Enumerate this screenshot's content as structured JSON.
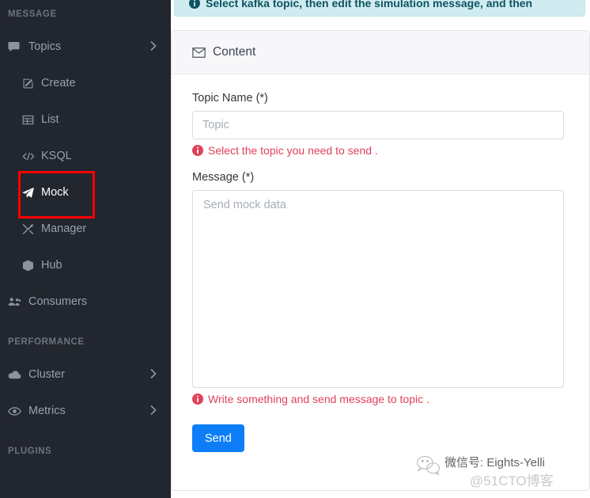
{
  "sidebar": {
    "sections": [
      {
        "title": "MESSAGE",
        "items": [
          {
            "label": "Topics",
            "icon": "comment-icon",
            "level": "top",
            "chevron": true,
            "active": false
          },
          {
            "label": "Create",
            "icon": "edit-icon",
            "level": "sub",
            "chevron": false,
            "active": false
          },
          {
            "label": "List",
            "icon": "table-icon",
            "level": "sub",
            "chevron": false,
            "active": false
          },
          {
            "label": "KSQL",
            "icon": "code-icon",
            "level": "sub",
            "chevron": false,
            "active": false
          },
          {
            "label": "Mock",
            "icon": "paper-plane-icon",
            "level": "sub",
            "chevron": false,
            "active": true
          },
          {
            "label": "Manager",
            "icon": "tools-icon",
            "level": "sub",
            "chevron": false,
            "active": false
          },
          {
            "label": "Hub",
            "icon": "cube-icon",
            "level": "sub",
            "chevron": false,
            "active": false
          },
          {
            "label": "Consumers",
            "icon": "users-icon",
            "level": "top",
            "chevron": false,
            "active": false
          }
        ]
      },
      {
        "title": "PERFORMANCE",
        "items": [
          {
            "label": "Cluster",
            "icon": "cloud-icon",
            "level": "top",
            "chevron": true,
            "active": false
          },
          {
            "label": "Metrics",
            "icon": "eye-icon",
            "level": "top",
            "chevron": true,
            "active": false
          }
        ]
      },
      {
        "title": "PLUGINS",
        "items": []
      }
    ],
    "highlight": {
      "target": "Mock",
      "color": "#fe0000"
    }
  },
  "alert": {
    "icon": "info-circle-icon",
    "text": "Select kafka topic, then edit the simulation message, and then",
    "background": "#d1ecf1",
    "border": "#bee5eb",
    "text_color": "#0c5460"
  },
  "card": {
    "header": {
      "icon": "envelope-icon",
      "title": "Content"
    },
    "fields": {
      "topic": {
        "label": "Topic Name (*)",
        "value": "",
        "placeholder": "Topic",
        "help_icon": "info-circle-icon",
        "help_text": "Select the topic you need to send ."
      },
      "message": {
        "label": "Message (*)",
        "value": "",
        "placeholder": "Send mock data",
        "help_icon": "info-circle-icon",
        "help_text": "Write something and send message to topic ."
      }
    },
    "submit": {
      "label": "Send",
      "color": "#0d7ef7"
    }
  },
  "watermark": {
    "icon": "wechat-icon",
    "line1": "微信号: Eights-Yelli",
    "line2": "@51CTO博客"
  },
  "colors": {
    "sidebar_bg": "#22262e",
    "sidebar_text": "#98a0ab",
    "sidebar_section": "#6d737d",
    "error_text": "#e0425a",
    "accent": "#0d7ef7"
  }
}
